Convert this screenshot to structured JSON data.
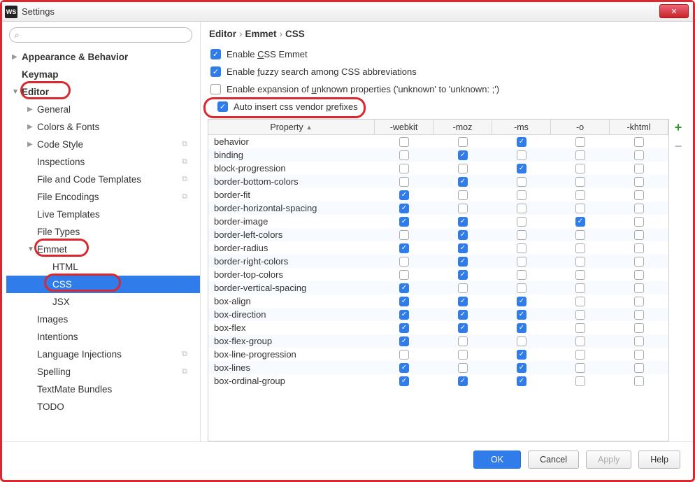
{
  "window": {
    "title": "Settings",
    "badge": "WS"
  },
  "search": {
    "placeholder": ""
  },
  "sidebar": {
    "items": [
      {
        "label": "Appearance & Behavior",
        "bold": true,
        "arrow": "▶",
        "indent": 0
      },
      {
        "label": "Keymap",
        "bold": true,
        "indent": 0
      },
      {
        "label": "Editor",
        "bold": true,
        "arrow": "▼",
        "indent": 0,
        "ring": true
      },
      {
        "label": "General",
        "arrow": "▶",
        "indent": 1
      },
      {
        "label": "Colors & Fonts",
        "arrow": "▶",
        "indent": 1
      },
      {
        "label": "Code Style",
        "arrow": "▶",
        "indent": 1,
        "copy": true
      },
      {
        "label": "Inspections",
        "indent": 1,
        "copy": true
      },
      {
        "label": "File and Code Templates",
        "indent": 1,
        "copy": true
      },
      {
        "label": "File Encodings",
        "indent": 1,
        "copy": true
      },
      {
        "label": "Live Templates",
        "indent": 1
      },
      {
        "label": "File Types",
        "indent": 1
      },
      {
        "label": "Emmet",
        "arrow": "▼",
        "indent": 1,
        "ring": true
      },
      {
        "label": "HTML",
        "indent": 2
      },
      {
        "label": "CSS",
        "indent": 2,
        "sel": true,
        "ring": true
      },
      {
        "label": "JSX",
        "indent": 2
      },
      {
        "label": "Images",
        "indent": 1
      },
      {
        "label": "Intentions",
        "indent": 1
      },
      {
        "label": "Language Injections",
        "indent": 1,
        "copy": true
      },
      {
        "label": "Spelling",
        "indent": 1,
        "copy": true
      },
      {
        "label": "TextMate Bundles",
        "indent": 1
      },
      {
        "label": "TODO",
        "indent": 1
      }
    ]
  },
  "breadcrumbs": [
    "Editor",
    "Emmet",
    "CSS"
  ],
  "options": [
    {
      "label_pre": "Enable ",
      "u": "C",
      "label_post": "SS Emmet",
      "checked": true
    },
    {
      "label_pre": "Enable ",
      "u": "f",
      "label_post": "uzzy search among CSS abbreviations",
      "checked": true
    },
    {
      "label_pre": "Enable expansion of ",
      "u": "u",
      "label_post": "nknown properties ('unknown' to 'unknown: ;')",
      "checked": false
    },
    {
      "label_pre": "Auto insert css vendor ",
      "u": "p",
      "label_post": "refixes",
      "checked": true,
      "ring": true
    }
  ],
  "table": {
    "header": {
      "prop": "Property",
      "cols": [
        "-webkit",
        "-moz",
        "-ms",
        "-o",
        "-khtml"
      ]
    },
    "rows": [
      {
        "p": "behavior",
        "v": [
          0,
          0,
          1,
          0,
          0
        ]
      },
      {
        "p": "binding",
        "v": [
          0,
          1,
          0,
          0,
          0
        ]
      },
      {
        "p": "block-progression",
        "v": [
          0,
          0,
          1,
          0,
          0
        ]
      },
      {
        "p": "border-bottom-colors",
        "v": [
          0,
          1,
          0,
          0,
          0
        ]
      },
      {
        "p": "border-fit",
        "v": [
          1,
          0,
          0,
          0,
          0
        ]
      },
      {
        "p": "border-horizontal-spacing",
        "v": [
          1,
          0,
          0,
          0,
          0
        ]
      },
      {
        "p": "border-image",
        "v": [
          1,
          1,
          0,
          1,
          0
        ]
      },
      {
        "p": "border-left-colors",
        "v": [
          0,
          1,
          0,
          0,
          0
        ]
      },
      {
        "p": "border-radius",
        "v": [
          1,
          1,
          0,
          0,
          0
        ]
      },
      {
        "p": "border-right-colors",
        "v": [
          0,
          1,
          0,
          0,
          0
        ]
      },
      {
        "p": "border-top-colors",
        "v": [
          0,
          1,
          0,
          0,
          0
        ]
      },
      {
        "p": "border-vertical-spacing",
        "v": [
          1,
          0,
          0,
          0,
          0
        ]
      },
      {
        "p": "box-align",
        "v": [
          1,
          1,
          1,
          0,
          0
        ]
      },
      {
        "p": "box-direction",
        "v": [
          1,
          1,
          1,
          0,
          0
        ]
      },
      {
        "p": "box-flex",
        "v": [
          1,
          1,
          1,
          0,
          0
        ]
      },
      {
        "p": "box-flex-group",
        "v": [
          1,
          0,
          0,
          0,
          0
        ]
      },
      {
        "p": "box-line-progression",
        "v": [
          0,
          0,
          1,
          0,
          0
        ]
      },
      {
        "p": "box-lines",
        "v": [
          1,
          0,
          1,
          0,
          0
        ]
      },
      {
        "p": "box-ordinal-group",
        "v": [
          1,
          1,
          1,
          0,
          0
        ]
      }
    ]
  },
  "buttons": {
    "ok": "OK",
    "cancel": "Cancel",
    "apply": "Apply",
    "help": "Help"
  }
}
